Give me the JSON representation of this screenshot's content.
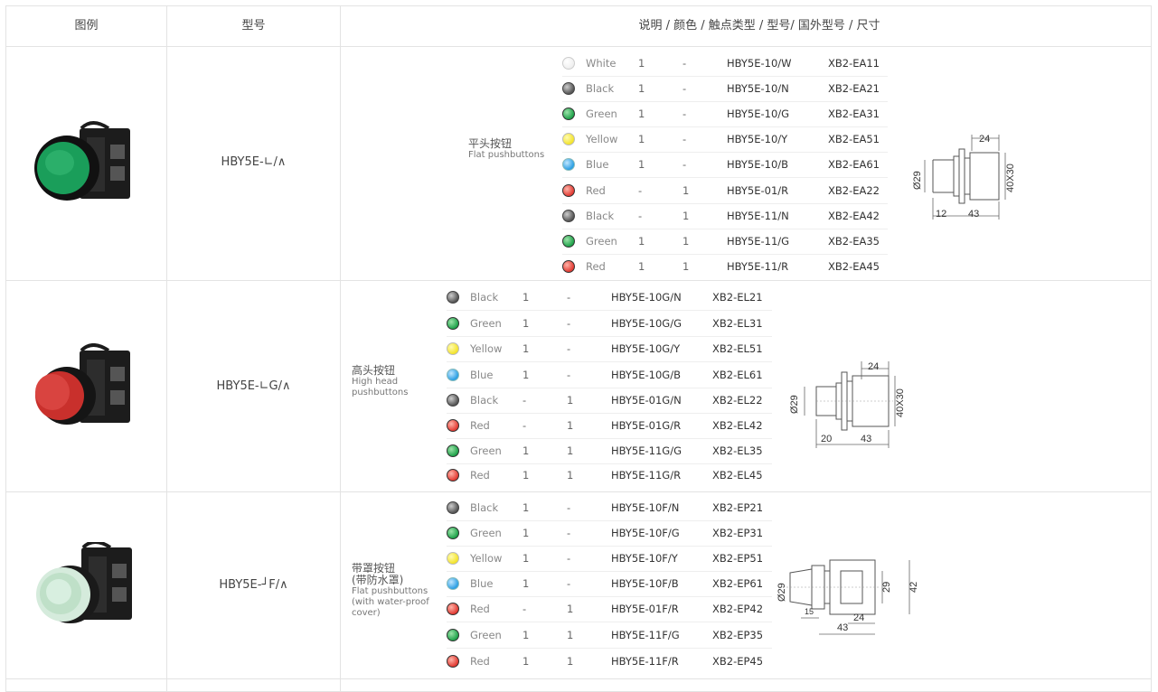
{
  "header": {
    "legend": "图例",
    "model": "型号",
    "spec": "说明 / 颜色 /   触点类型 /  型号/  国外型号 /  尺寸"
  },
  "sections": [
    {
      "model": "HBY5E-∟/∧",
      "desc_cn": "平头按钮",
      "desc_en": [
        "Flat pushbuttons"
      ],
      "button_color": "#1a9e5a",
      "rows": [
        {
          "color": "White",
          "dot": "#ffffff",
          "n1": "1",
          "n2": "-",
          "model": "HBY5E-10/W",
          "ext": "XB2-EA11"
        },
        {
          "color": "Black",
          "dot": "#555555",
          "n1": "1",
          "n2": "-",
          "model": "HBY5E-10/N",
          "ext": "XB2-EA21"
        },
        {
          "color": "Green",
          "dot": "#1fa24a",
          "n1": "1",
          "n2": "-",
          "model": "HBY5E-10/G",
          "ext": "XB2-EA31"
        },
        {
          "color": "Yellow",
          "dot": "#f3e32a",
          "n1": "1",
          "n2": "-",
          "model": "HBY5E-10/Y",
          "ext": "XB2-EA51"
        },
        {
          "color": "Blue",
          "dot": "#2a9ee3",
          "n1": "1",
          "n2": "-",
          "model": "HBY5E-10/B",
          "ext": "XB2-EA61"
        },
        {
          "color": "Red",
          "dot": "#e23a32",
          "n1": "-",
          "n2": "1",
          "model": "HBY5E-01/R",
          "ext": "XB2-EA22"
        },
        {
          "color": "Black",
          "dot": "#555555",
          "n1": "-",
          "n2": "1",
          "model": "HBY5E-11/N",
          "ext": "XB2-EA42"
        },
        {
          "color": "Green",
          "dot": "#1fa24a",
          "n1": "1",
          "n2": "1",
          "model": "HBY5E-11/G",
          "ext": "XB2-EA35"
        },
        {
          "color": "Red",
          "dot": "#e23a32",
          "n1": "1",
          "n2": "1",
          "model": "HBY5E-11/R",
          "ext": "XB2-EA45"
        }
      ],
      "dims": {
        "d": "Ø29",
        "a": "24",
        "b": "12",
        "c": "43",
        "e": "40X30"
      }
    },
    {
      "model": "HBY5E-∟G/∧",
      "desc_cn": "高头按钮",
      "desc_en": [
        "High head",
        "pushbuttons"
      ],
      "button_color": "#d43a36",
      "rows": [
        {
          "color": "Black",
          "dot": "#555555",
          "n1": "1",
          "n2": "-",
          "model": "HBY5E-10G/N",
          "ext": "XB2-EL21"
        },
        {
          "color": "Green",
          "dot": "#1fa24a",
          "n1": "1",
          "n2": "-",
          "model": "HBY5E-10G/G",
          "ext": "XB2-EL31"
        },
        {
          "color": "Yellow",
          "dot": "#f3e32a",
          "n1": "1",
          "n2": "-",
          "model": "HBY5E-10G/Y",
          "ext": "XB2-EL51"
        },
        {
          "color": "Blue",
          "dot": "#2a9ee3",
          "n1": "1",
          "n2": "-",
          "model": "HBY5E-10G/B",
          "ext": "XB2-EL61"
        },
        {
          "color": "Black",
          "dot": "#555555",
          "n1": "-",
          "n2": "1",
          "model": "HBY5E-01G/N",
          "ext": "XB2-EL22"
        },
        {
          "color": "Red",
          "dot": "#e23a32",
          "n1": "-",
          "n2": "1",
          "model": "HBY5E-01G/R",
          "ext": "XB2-EL42"
        },
        {
          "color": "Green",
          "dot": "#1fa24a",
          "n1": "1",
          "n2": "1",
          "model": "HBY5E-11G/G",
          "ext": "XB2-EL35"
        },
        {
          "color": "Red",
          "dot": "#e23a32",
          "n1": "1",
          "n2": "1",
          "model": "HBY5E-11G/R",
          "ext": "XB2-EL45"
        }
      ],
      "dims": {
        "d": "Ø29",
        "a": "24",
        "b": "20",
        "c": "43",
        "e": "40X30"
      }
    },
    {
      "model": "HBY5E-┘F/∧",
      "desc_cn": "带罩按钮",
      "desc_cn2": "(带防水罩)",
      "desc_en": [
        "Flat pushbuttons",
        "(with water-proof",
        "cover)"
      ],
      "button_color": "#c7e6cf",
      "rows": [
        {
          "color": "Black",
          "dot": "#555555",
          "n1": "1",
          "n2": "-",
          "model": "HBY5E-10F/N",
          "ext": "XB2-EP21"
        },
        {
          "color": "Green",
          "dot": "#1fa24a",
          "n1": "1",
          "n2": "-",
          "model": "HBY5E-10F/G",
          "ext": "XB2-EP31"
        },
        {
          "color": "Yellow",
          "dot": "#f3e32a",
          "n1": "1",
          "n2": "-",
          "model": "HBY5E-10F/Y",
          "ext": "XB2-EP51"
        },
        {
          "color": "Blue",
          "dot": "#2a9ee3",
          "n1": "1",
          "n2": "-",
          "model": "HBY5E-10F/B",
          "ext": "XB2-EP61"
        },
        {
          "color": "Red",
          "dot": "#e23a32",
          "n1": "-",
          "n2": "1",
          "model": "HBY5E-01F/R",
          "ext": "XB2-EP42"
        },
        {
          "color": "Green",
          "dot": "#1fa24a",
          "n1": "1",
          "n2": "1",
          "model": "HBY5E-11F/G",
          "ext": "XB2-EP35"
        },
        {
          "color": "Red",
          "dot": "#e23a32",
          "n1": "1",
          "n2": "1",
          "model": "HBY5E-11F/R",
          "ext": "XB2-EP45"
        }
      ],
      "dims": {
        "d": "Ø29",
        "a": "24",
        "b": "15",
        "c": "43",
        "e": "29",
        "f": "42"
      }
    }
  ]
}
